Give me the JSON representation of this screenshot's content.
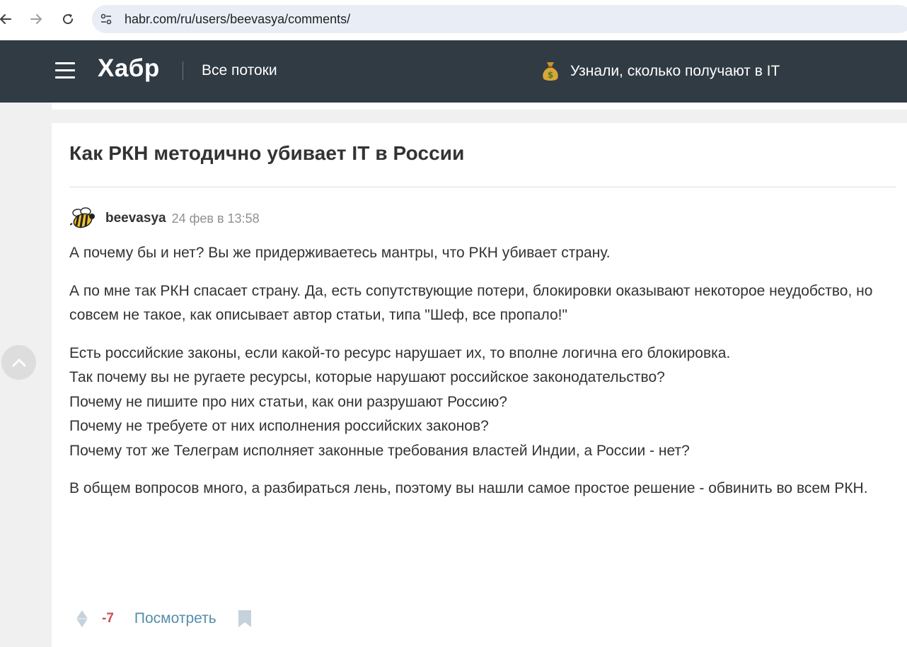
{
  "browser": {
    "url": "habr.com/ru/users/beevasya/comments/",
    "icons": {
      "back": "arrow-left-icon",
      "forward": "arrow-right-icon",
      "reload": "reload-icon",
      "site_info": "tune-icon"
    }
  },
  "header": {
    "logo": "Хабр",
    "nav_label": "Все потоки",
    "promo_text": "Узнали, сколько получают в IT",
    "promo_icon": "money-bag-icon",
    "background_color": "#303b44"
  },
  "post": {
    "title": "Как РКН методично убивает IT в России"
  },
  "comment": {
    "author": "beevasya",
    "timestamp": "24 фев в 13:58",
    "avatar_icon": "bee-avatar-icon",
    "paragraphs": [
      [
        "А почему бы и нет? Вы же придерживаетесь мантры, что РКН убивает страну."
      ],
      [
        "А по мне так РКН спасает страну. Да, есть сопутствующие потери, блокировки оказывают некоторое неудобство, но совсем не такое, как описывает автор статьи, типа \"Шеф, все пропало!\""
      ],
      [
        "Есть российские законы, если какой-то ресурс нарушает их, то вполне логична его блокировка.",
        "Так почему вы не ругаете ресурсы, которые нарушают российское законодательство?",
        "Почему не пишите про них статьи, как они разрушают Россию?",
        "Почему не требуете от них исполнения российских законов?",
        "Почему тот же Телеграм исполняет законные требования властей Индии, а России - нет?"
      ],
      [
        "В общем вопросов много, а разбираться лень, поэтому вы нашли самое простое решение - обвинить во всем РКН."
      ]
    ],
    "score": "-7",
    "score_color": "#d04e4e",
    "view_link": "Посмотреть",
    "link_color": "#548eaa"
  },
  "controls": {
    "scroll_up_icon": "chevron-up-icon",
    "vote_icon": "vote-diamond-icon",
    "bookmark_icon": "bookmark-icon"
  }
}
